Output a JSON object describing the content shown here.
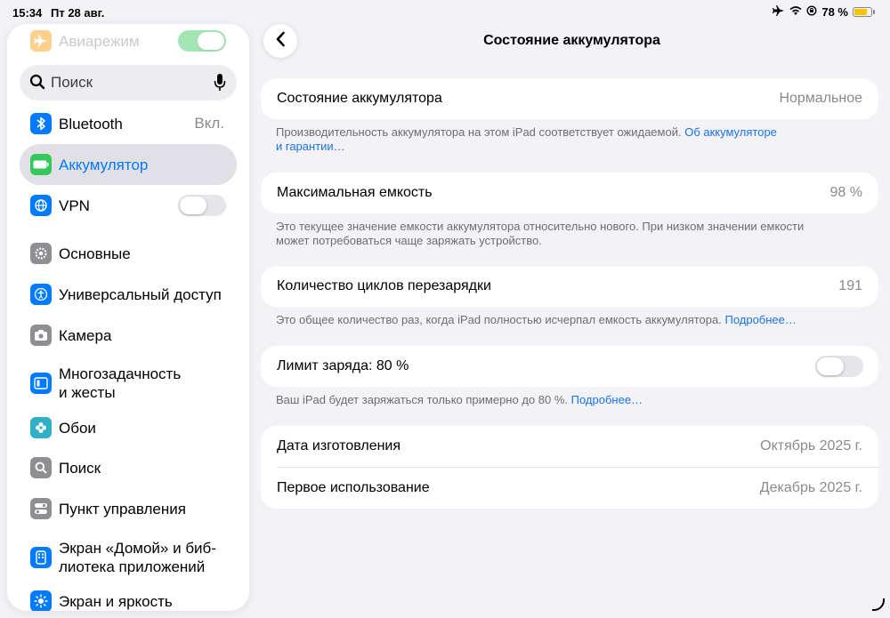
{
  "status_bar": {
    "time": "15:34",
    "date": "Пт 28 авг.",
    "battery_percent": "78 %",
    "battery_level": 0.78,
    "icons": [
      "airplane-icon",
      "wifi-icon",
      "lock-rotation-icon",
      "battery-icon"
    ]
  },
  "sidebar": {
    "airplane": {
      "label": "Авиарежим",
      "icon": "airplane-icon",
      "color": "#ff9500",
      "toggle_on": true
    },
    "search": {
      "placeholder": "Поиск"
    },
    "bluetooth": {
      "label": "Bluetooth",
      "value": "Вкл.",
      "icon": "bluetooth-icon",
      "color": "#007aff"
    },
    "battery": {
      "label": "Аккумулятор",
      "icon": "battery-icon",
      "color": "#34c759",
      "selected": true
    },
    "vpn": {
      "label": "VPN",
      "icon": "globe-icon",
      "color": "#007aff",
      "toggle_on": false
    },
    "general": {
      "label": "Основные",
      "icon": "gear-icon",
      "color": "#8e8e93"
    },
    "accessibility": {
      "label": "Универсальный доступ",
      "icon": "accessibility-icon",
      "color": "#007aff"
    },
    "camera": {
      "label": "Камера",
      "icon": "camera-icon",
      "color": "#8e8e93"
    },
    "multitasking": {
      "label_line1": "Многозадачность",
      "label_line2": "и жесты",
      "icon": "multitasking-icon",
      "color": "#007aff"
    },
    "wallpaper": {
      "label": "Обои",
      "icon": "flower-icon",
      "color": "#30b0c7"
    },
    "search_item": {
      "label": "Поиск",
      "icon": "search-icon",
      "color": "#8e8e93"
    },
    "control_center": {
      "label": "Пункт управления",
      "icon": "switches-icon",
      "color": "#8e8e93"
    },
    "home_screen": {
      "label_line1": "Экран «Домой» и биб-",
      "label_line2": "лиотека приложений",
      "icon": "home-screen-icon",
      "color": "#007aff"
    },
    "display": {
      "label": "Экран и яркость",
      "icon": "sun-icon",
      "color": "#007aff"
    }
  },
  "main": {
    "title": "Состояние аккумулятора",
    "health": {
      "label": "Состояние аккумулятора",
      "value": "Нормальное",
      "footnote": "Производительность аккумулятора на этом iPad соответствует ожидаемой.",
      "link_line1": "Об аккумуляторе",
      "link_line2": "и гарантии…"
    },
    "capacity": {
      "label": "Максимальная емкость",
      "value": "98 %",
      "footnote_line1": "Это текущее значение емкости аккумулятора относительно нового. При низком значении емкости",
      "footnote_line2": "может потребоваться чаще заряжать устройство."
    },
    "cycles": {
      "label": "Количество циклов перезарядки",
      "value": "191",
      "footnote": "Это общее количество раз, когда iPad полностью исчерпал емкость аккумулятора.",
      "link": "Подробнее…"
    },
    "limit": {
      "label": "Лимит заряда: 80 %",
      "toggle_on": false,
      "footnote": "Ваш iPad будет заряжаться только примерно до 80 %.",
      "link": "Подробнее…"
    },
    "manufacture": {
      "label": "Дата изготовления",
      "value": "Октябрь 2025 г."
    },
    "first_use": {
      "label": "Первое использование",
      "value": "Декабрь 2025 г."
    }
  },
  "colors": {
    "accent": "#007aff",
    "background": "#f2f2f7",
    "selected_row": "#e0e0e6"
  }
}
